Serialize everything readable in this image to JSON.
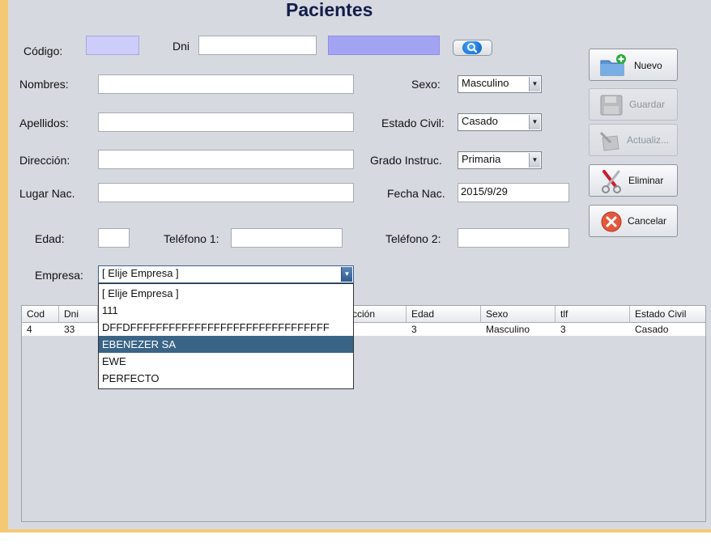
{
  "title": "Pacientes",
  "form": {
    "codigo_label": "Código:",
    "codigo_value": "",
    "dni_label": "Dni",
    "dni_value": "",
    "dni_lookup_value": "",
    "nombres_label": "Nombres:",
    "nombres_value": "",
    "apellidos_label": "Apellidos:",
    "apellidos_value": "",
    "direccion_label": "Dirección:",
    "direccion_value": "",
    "lugar_nac_label": "Lugar Nac.",
    "lugar_nac_value": "",
    "edad_label": "Edad:",
    "edad_value": "",
    "telefono1_label": "Teléfono 1:",
    "telefono1_value": "",
    "telefono2_label": "Teléfono 2:",
    "telefono2_value": "",
    "sexo_label": "Sexo:",
    "sexo_value": "Masculino",
    "estado_civil_label": "Estado Civil:",
    "estado_civil_value": "Casado",
    "grado_label": "Grado Instruc.",
    "grado_value": "Primaria",
    "fecha_nac_label": "Fecha Nac.",
    "fecha_nac_value": "2015/9/29",
    "empresa_label": "Empresa:",
    "empresa_value": "[ Elije Empresa ]"
  },
  "empresa_options": [
    "[ Elije Empresa ]",
    "111",
    "DFFDFFFFFFFFFFFFFFFFFFFFFFFFFFFFFFF",
    "EBENEZER SA",
    "EWE",
    "PERFECTO"
  ],
  "empresa_highlighted": "EBENEZER SA",
  "buttons": {
    "nuevo": "Nuevo",
    "guardar": "Guardar",
    "actualizar": "Actualiz...",
    "eliminar": "Eliminar",
    "cancelar": "Cancelar"
  },
  "table": {
    "columns": [
      "Cod",
      "Dni",
      "",
      "cción",
      "Edad",
      "Sexo",
      "tlf",
      "Estado Civil"
    ],
    "rows": [
      [
        "4",
        "33",
        "",
        "",
        "3",
        "Masculino",
        "3",
        "Casado"
      ]
    ]
  },
  "colors": {
    "frame_border": "#f3ca73",
    "panel_bg": "#d6d9df",
    "title": "#141d4a",
    "selection": "#3a6486"
  }
}
